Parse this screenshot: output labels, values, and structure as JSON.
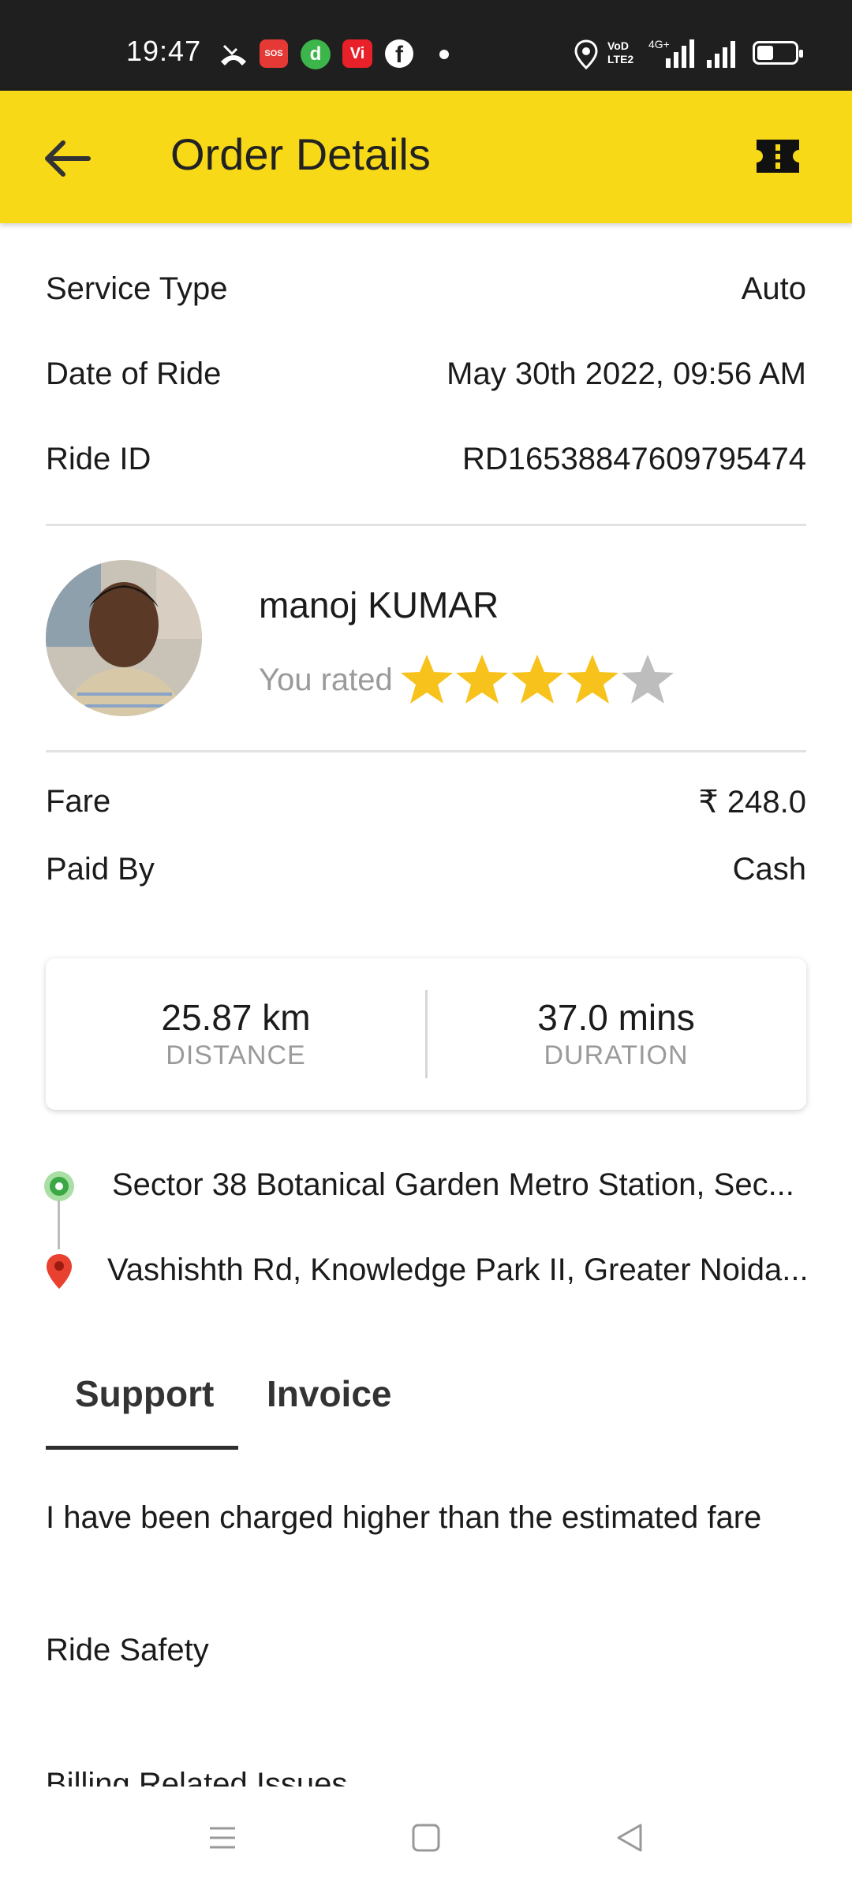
{
  "status_bar": {
    "time": "19:47",
    "icons": [
      "missed-call-icon",
      "sos-icon",
      "app-d-icon",
      "vi-icon",
      "facebook-icon",
      "dot-icon",
      "location-icon",
      "volte-icon",
      "4g-signal-icon",
      "signal-icon",
      "battery-icon"
    ],
    "sos_label": "SOS",
    "vi_label": "Vi",
    "volte_label": "VoD LTE2",
    "network_label": "4G+"
  },
  "header": {
    "title": "Order Details",
    "background": "#f7d917"
  },
  "ride_info": {
    "service_type_label": "Service Type",
    "service_type_value": "Auto",
    "date_label": "Date of Ride",
    "date_value": "May 30th 2022, 09:56 AM",
    "ride_id_label": "Ride ID",
    "ride_id_value": "RD16538847609795474"
  },
  "driver": {
    "name": "manoj KUMAR",
    "rated_label": "You rated",
    "rating": 4,
    "rating_max": 5,
    "star_color": "#f7c21b",
    "star_empty_color": "#bdbdbd"
  },
  "payment": {
    "fare_label": "Fare",
    "fare_value": "₹ 248.0",
    "paid_by_label": "Paid By",
    "paid_by_value": "Cash"
  },
  "stats": {
    "distance_value": "25.87 km",
    "distance_label": "DISTANCE",
    "duration_value": "37.0 mins",
    "duration_label": "DURATION"
  },
  "route": {
    "pickup": "Sector 38 Botanical Garden Metro Station, Sec...",
    "drop": "Vashishth Rd, Knowledge Park II, Greater Noida..."
  },
  "tabs": [
    {
      "label": "Support",
      "active": true
    },
    {
      "label": "Invoice",
      "active": false
    }
  ],
  "support_items": [
    "I have been charged higher than the estimated fare",
    "Ride Safety",
    "Billing Related Issues"
  ],
  "nav_bar": {
    "icons": [
      "menu-icon",
      "home-icon",
      "back-icon"
    ]
  }
}
